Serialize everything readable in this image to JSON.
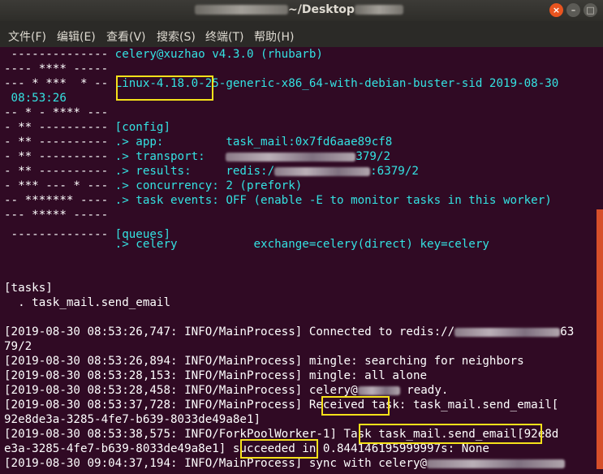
{
  "window": {
    "title": "~/Desktop",
    "close_icon": "×",
    "minimize_icon": "–",
    "maximize_icon": "□"
  },
  "menu": {
    "file": "文件(F)",
    "edit": "编辑(E)",
    "view": "查看(V)",
    "search": "搜索(S)",
    "terminal": "终端(T)",
    "help": "帮助(H)"
  },
  "banner": {
    "l1_art": " -------------- ",
    "l1_text": "celery@xuzhao v4.3.0 (rhubarb)",
    "l2_art": "---- **** -----",
    "l3_art": "--- * ***  * -- ",
    "l3_text": "Linux-4.18.0-25-generic-x86_64-with-debian-buster-sid 2019-08-30",
    "l4_text": " 08:53:26",
    "l5_art": "-- * - **** ---",
    "l6_art": "- ** ---------- ",
    "l6_text": "[config]",
    "l7_art": "- ** ---------- ",
    "l7_text": ".> app:         task_mail:0x7fd6aae89cf8",
    "l8_art": "- ** ---------- ",
    "l8_text": ".> transport:   ",
    "l8_tail": "379/2",
    "l9_art": "- ** ---------- ",
    "l9_text": ".> results:     redis:/",
    "l9_tail": ":6379/2",
    "l10_art": "- *** --- * --- ",
    "l10_text": ".> concurrency: 2 (prefork)",
    "l11_art": "-- ******* ---- ",
    "l11_text": ".> task events: OFF (enable -E to monitor tasks in this worker)",
    "l12_art": "--- ***** -----",
    "l13_art": " -------------- ",
    "l13_text": "[queues]",
    "l14_text": "                .> celery           exchange=celery(direct) key=celery"
  },
  "tasks": {
    "header": "[tasks]",
    "item": "  . task_mail.send_email"
  },
  "log": {
    "l1": "[2019-08-30 08:53:26,747: INFO/MainProcess] Connected to redis://",
    "l1_tail": "63",
    "l2": "79/2",
    "l3": "[2019-08-30 08:53:26,894: INFO/MainProcess] mingle: searching for neighbors",
    "l4": "[2019-08-30 08:53:28,153: INFO/MainProcess] mingle: all alone",
    "l5": "[2019-08-30 08:53:28,458: INFO/MainProcess] celery@",
    "l5_tail": " ready.",
    "l6": "[2019-08-30 08:53:37,728: INFO/MainProcess] Received task: task_mail.send_email[",
    "l7": "92e8de3a-3285-4fe7-b639-8033de49a8e1]",
    "l8": "[2019-08-30 08:53:38,575: INFO/ForkPoolWorker-1] Task task_mail.send_email[92e8d",
    "l9": "e3a-3285-4fe7-b639-8033de49a8e1] succeeded in 0.844146195999997s: None",
    "l10": "[2019-08-30 09:04:37,194: INFO/MainProcess] sync with celery@"
  },
  "colors": {
    "terminal_bg": "#300a24",
    "banner_text": "#34e2e2",
    "highlight": "#f5e11a"
  }
}
